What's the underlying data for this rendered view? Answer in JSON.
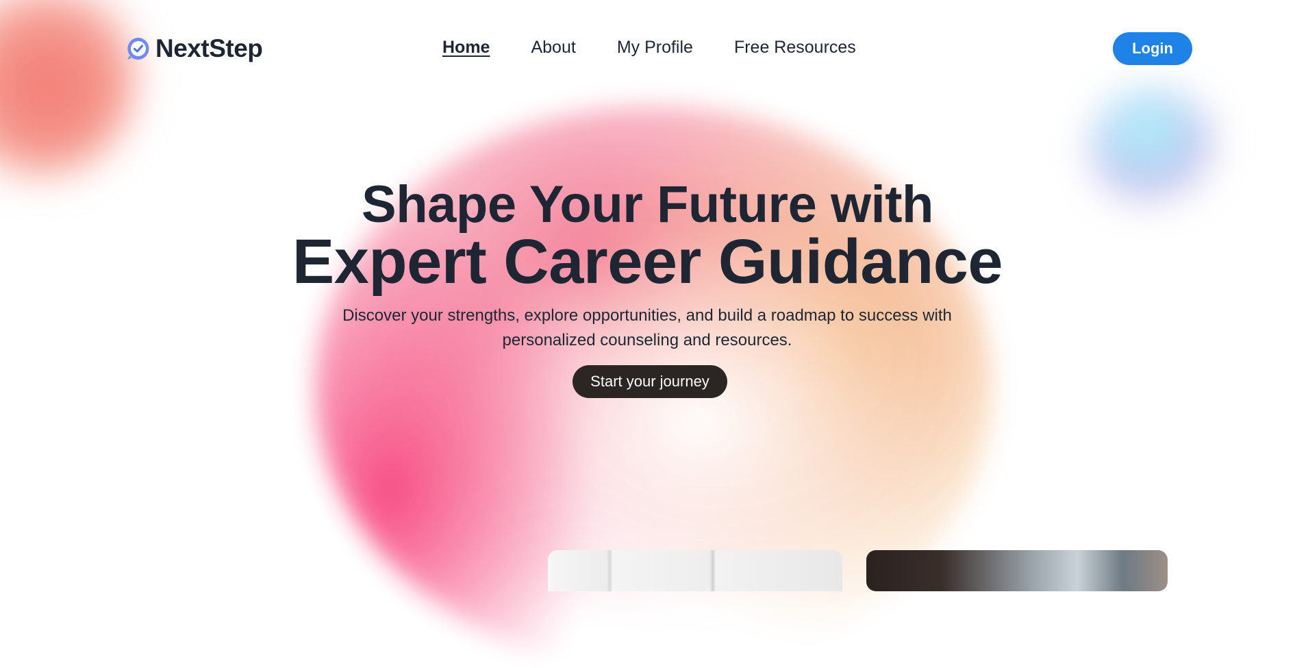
{
  "brand": {
    "name": "NextStep",
    "icon": "check-badge-icon"
  },
  "nav": {
    "items": [
      {
        "label": "Home",
        "active": true
      },
      {
        "label": "About",
        "active": false
      },
      {
        "label": "My Profile",
        "active": false
      },
      {
        "label": "Free Resources",
        "active": false
      }
    ],
    "login_label": "Login"
  },
  "hero": {
    "headline_line1": "Shape Your Future with",
    "headline_line2": "Expert Career Guidance",
    "subtitle": "Discover your strengths, explore opportunities, and build a roadmap to success with personalized counseling and resources.",
    "cta_label": "Start your journey"
  },
  "colors": {
    "text": "#1f2633",
    "login_bg": "#1f82e6",
    "cta_bg": "#2b2523",
    "logo_icon": "#5b7cf0"
  }
}
